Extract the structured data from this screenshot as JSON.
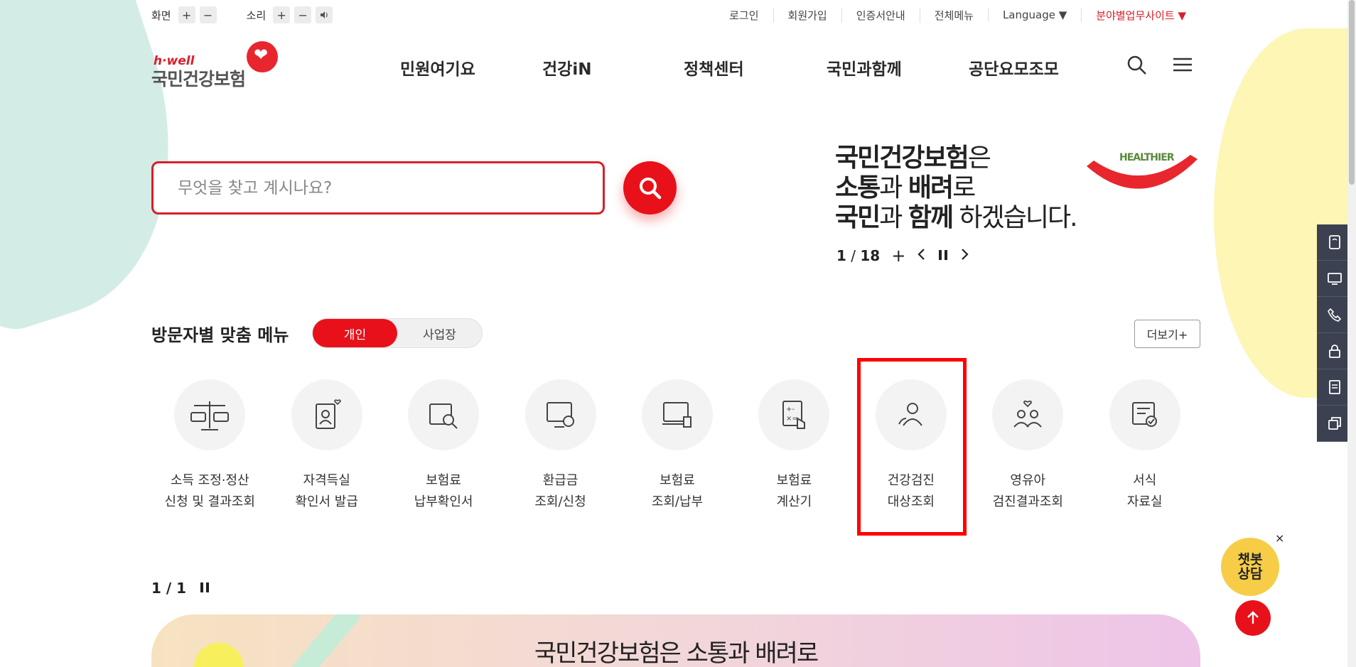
{
  "utility": {
    "screen_label": "화면",
    "sound_label": "소리",
    "plus": "+",
    "minus": "−",
    "links": [
      "로그인",
      "회원가입",
      "인증서안내",
      "전체메뉴",
      "Language ▼",
      "분야별업무사이트 ▼"
    ]
  },
  "header": {
    "logo_small": "h·well",
    "logo_name": "국민건강보험",
    "nav": [
      "민원여기요",
      "건강iN",
      "정책센터",
      "국민과함께",
      "공단요모조모"
    ]
  },
  "search": {
    "placeholder": "무엇을 찾고 계시나요?"
  },
  "banner": {
    "line1_bold": "국민건강보험",
    "line1_rest": "은",
    "line2_bold1": "소통",
    "line2_mid": "과 ",
    "line2_bold2": "배려",
    "line2_rest": "로",
    "line3_bold1": "국민",
    "line3_mid": "과 ",
    "line3_bold2": "함께",
    "line3_rest": " 하겠습니다.",
    "healthier": "HEALTHIER",
    "page_current": "1",
    "page_sep": " / ",
    "page_total": "18"
  },
  "quick_menu": {
    "title": "방문자별 맞춤 메뉴",
    "toggle_personal": "개인",
    "toggle_business": "사업장",
    "more": "더보기+",
    "items": [
      {
        "line1": "소득 조정·정산",
        "line2": "신청 및 결과조회"
      },
      {
        "line1": "자격득실",
        "line2": "확인서 발급"
      },
      {
        "line1": "보험료",
        "line2": "납부확인서"
      },
      {
        "line1": "환급금",
        "line2": "조회/신청"
      },
      {
        "line1": "보험료",
        "line2": "조회/납부"
      },
      {
        "line1": "보험료",
        "line2": "계산기"
      },
      {
        "line1": "건강검진",
        "line2": "대상조회"
      },
      {
        "line1": "영유아",
        "line2": "검진결과조회"
      },
      {
        "line1": "서식",
        "line2": "자료실"
      }
    ],
    "pager": "1 / 1"
  },
  "bottom_banner": {
    "title": "국민건강보험은 소통과 배려로"
  },
  "chatbot": {
    "line1": "챗봇",
    "line2": "상담",
    "close": "×"
  },
  "colors": {
    "accent": "#e8111a",
    "dock": "#3b4150",
    "chatbot": "#f7cd48"
  }
}
